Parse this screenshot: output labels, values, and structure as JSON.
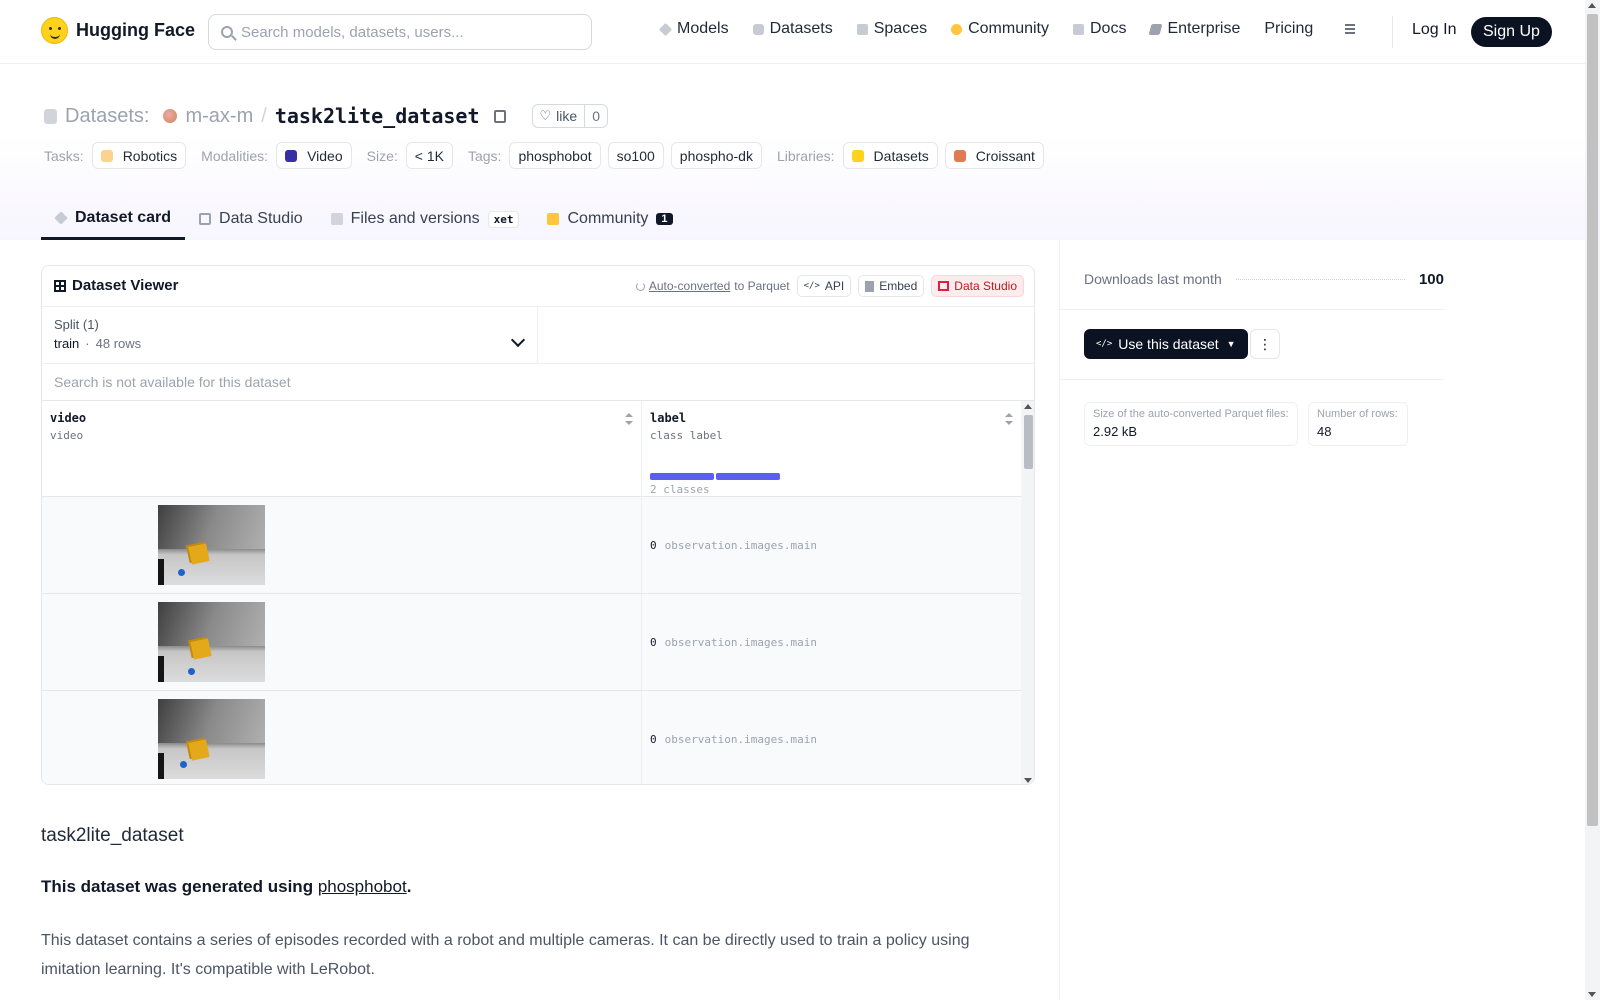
{
  "header": {
    "logo_text": "Hugging Face",
    "search_placeholder": "Search models, datasets, users...",
    "nav": [
      {
        "label": "Models",
        "icon": "cube-icon"
      },
      {
        "label": "Datasets",
        "icon": "database-icon"
      },
      {
        "label": "Spaces",
        "icon": "spaces-icon"
      },
      {
        "label": "Community",
        "icon": "community-icon"
      },
      {
        "label": "Docs",
        "icon": "book-icon"
      },
      {
        "label": "Enterprise",
        "icon": "enterprise-icon"
      },
      {
        "label": "Pricing"
      }
    ],
    "login": "Log In",
    "signup": "Sign Up"
  },
  "repo": {
    "type_label": "Datasets:",
    "owner": "m-ax-m",
    "separator": "/",
    "name": "task2lite_dataset",
    "like_label": "like",
    "like_count": "0"
  },
  "tags": {
    "tasks_label": "Tasks:",
    "tasks": [
      "Robotics"
    ],
    "modalities_label": "Modalities:",
    "modalities": [
      "Video"
    ],
    "size_label": "Size:",
    "size": "< 1K",
    "tags_label": "Tags:",
    "tags": [
      "phosphobot",
      "so100",
      "phospho-dk"
    ],
    "libraries_label": "Libraries:",
    "libraries": [
      "Datasets",
      "Croissant"
    ]
  },
  "tabs": [
    {
      "label": "Dataset card",
      "active": true
    },
    {
      "label": "Data Studio"
    },
    {
      "label": "Files and versions",
      "badge": "xet"
    },
    {
      "label": "Community",
      "count": "1"
    }
  ],
  "viewer": {
    "title": "Dataset Viewer",
    "auto_converted": "Auto-converted",
    "to_parquet": "to Parquet",
    "api": "API",
    "embed": "Embed",
    "data_studio": "Data Studio",
    "split_label": "Split (1)",
    "split_name": "train",
    "split_dot": "·",
    "split_rows": "48 rows",
    "search_notice": "Search is not available for this dataset",
    "columns": [
      {
        "name": "video",
        "type": "video"
      },
      {
        "name": "label",
        "type": "class label",
        "classes": "2 classes",
        "class_fractions": [
          0.5,
          0.5
        ]
      }
    ],
    "rows": [
      {
        "label_value": "0",
        "label_name": "observation.images.main"
      },
      {
        "label_value": "0",
        "label_name": "observation.images.main"
      },
      {
        "label_value": "0",
        "label_name": "observation.images.main"
      }
    ]
  },
  "card": {
    "title": "task2lite_dataset",
    "generated_prefix": "This dataset was generated using ",
    "generated_link": "phosphobot",
    "generated_suffix": ".",
    "description": "This dataset contains a series of episodes recorded with a robot and multiple cameras. It can be directly used to train a policy using imitation learning. It's compatible with LeRobot."
  },
  "sidebar": {
    "downloads_label": "Downloads last month",
    "downloads_value": "100",
    "use_button": "Use this dataset",
    "parquet_size_label": "Size of the auto-converted Parquet files:",
    "parquet_size_value": "2.92 kB",
    "rows_label": "Number of rows:",
    "rows_value": "48"
  }
}
